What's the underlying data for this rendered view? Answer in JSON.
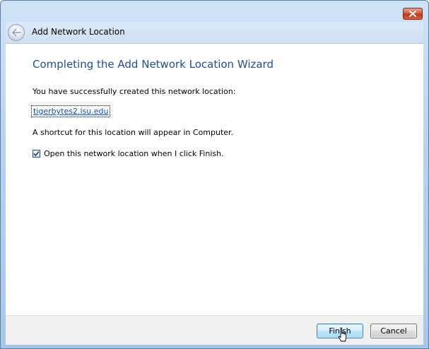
{
  "window": {
    "title": "Add Network Location"
  },
  "icons": {
    "close": "close-icon",
    "back": "back-arrow-icon",
    "checkbox": "checkmark-icon",
    "cursor": "hand-pointer-cursor-icon"
  },
  "content": {
    "heading": "Completing the Add Network Location Wizard",
    "success_text": "You have successfully created this network location:",
    "location_link": "tigerbytes2.lsu.edu",
    "shortcut_text": "A shortcut for this location will appear in Computer.",
    "open_checkbox": {
      "label": "Open this network location when I click Finish.",
      "checked": true
    }
  },
  "footer": {
    "finish_label": "Finish",
    "cancel_label": "Cancel"
  },
  "colors": {
    "heading": "#1f4e99",
    "link": "#0b4fbf",
    "frame": "#b9d3ee",
    "close_button": "#c0381e",
    "footer": "#f0f0f0"
  }
}
